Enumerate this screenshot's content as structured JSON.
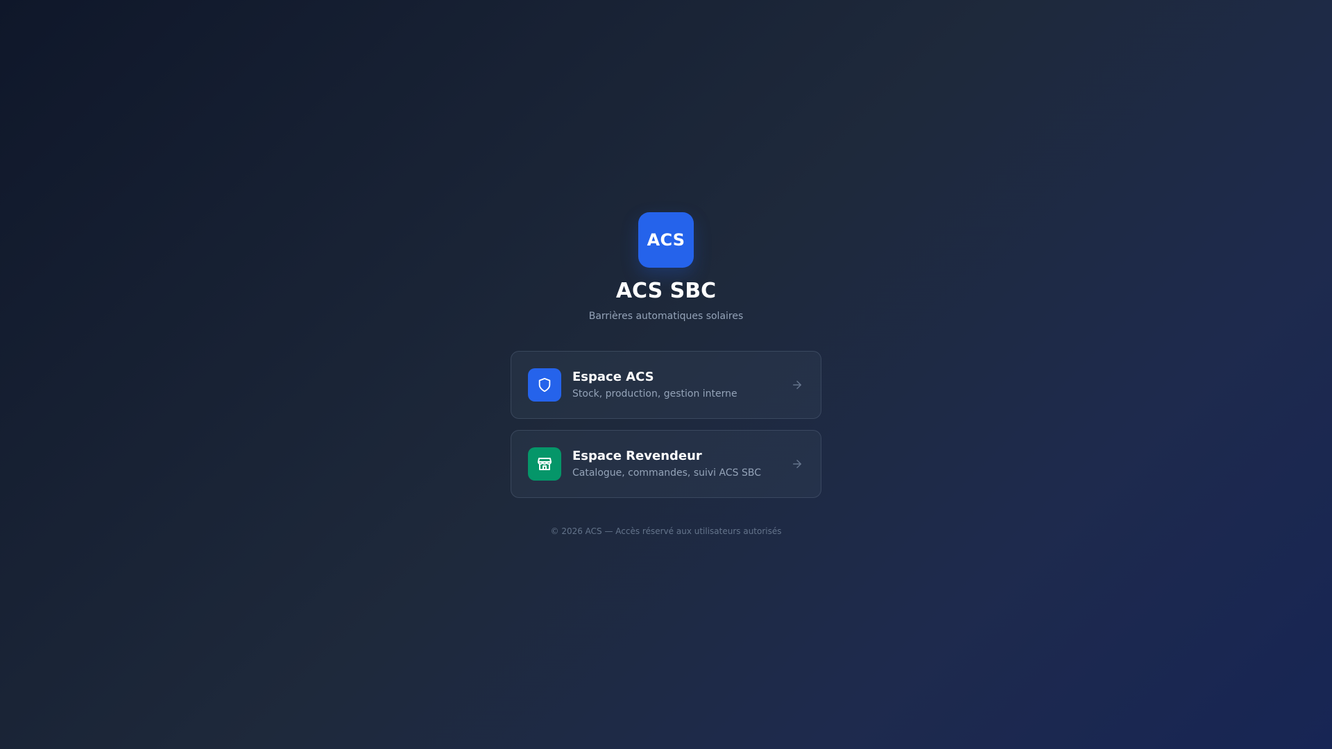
{
  "brand": {
    "logo_text": "ACS",
    "logo_color": "#2563eb",
    "title": "ACS SBC",
    "subtitle": "Barrières automatiques solaires"
  },
  "cards": [
    {
      "title": "Espace ACS",
      "description": "Stock, production, gestion interne",
      "icon": "shield-icon",
      "icon_bg": "#2563eb"
    },
    {
      "title": "Espace Revendeur",
      "description": "Catalogue, commandes, suivi ACS SBC",
      "icon": "store-icon",
      "icon_bg": "#059669"
    }
  ],
  "footer": {
    "text": "© 2026 ACS — Accès réservé aux utilisateurs autorisés"
  }
}
